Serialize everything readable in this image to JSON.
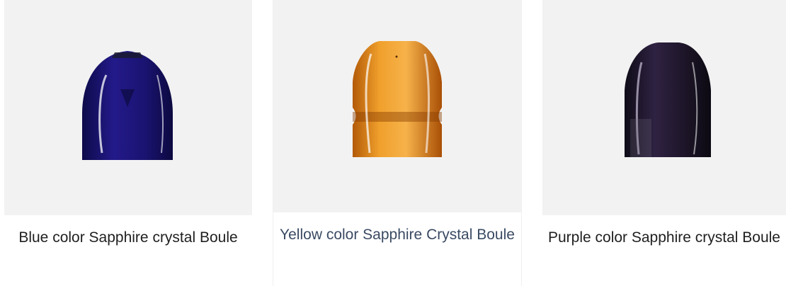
{
  "products": [
    {
      "label": "Blue color Sapphire crystal Boule",
      "color": "#20177a",
      "image": "blue-sapphire-boule"
    },
    {
      "label": "Yellow color Sapphire Crystal Boule",
      "color": "#d9821a",
      "image": "yellow-sapphire-boule"
    },
    {
      "label": "Purple color Sapphire crystal Boule",
      "color": "#241a2e",
      "image": "purple-sapphire-boule"
    }
  ]
}
